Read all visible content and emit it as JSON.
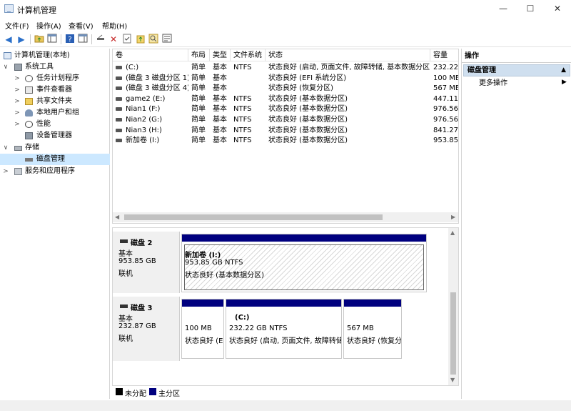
{
  "window": {
    "title": "计算机管理",
    "controls": {
      "minimize": "—",
      "maximize": "☐",
      "close": "✕"
    }
  },
  "menu": [
    "文件(F)",
    "操作(A)",
    "查看(V)",
    "帮助(H)"
  ],
  "toolbar": [
    "back-icon",
    "forward-icon",
    "folder-up-icon",
    "show-hide-tree-icon",
    "help-icon",
    "view-icon",
    "connect-icon",
    "delete-icon",
    "check-icon",
    "open-icon",
    "search-icon",
    "properties-icon"
  ],
  "tree": [
    {
      "label": "计算机管理(本地)",
      "level": 0,
      "twisty": ""
    },
    {
      "label": "系统工具",
      "level": 1,
      "twisty": "∨"
    },
    {
      "label": "任务计划程序",
      "level": 2,
      "twisty": ">"
    },
    {
      "label": "事件查看器",
      "level": 2,
      "twisty": ">"
    },
    {
      "label": "共享文件夹",
      "level": 2,
      "twisty": ">"
    },
    {
      "label": "本地用户和组",
      "level": 2,
      "twisty": ">"
    },
    {
      "label": "性能",
      "level": 2,
      "twisty": ">"
    },
    {
      "label": "设备管理器",
      "level": 2,
      "twisty": ""
    },
    {
      "label": "存储",
      "level": 1,
      "twisty": "∨"
    },
    {
      "label": "磁盘管理",
      "level": 2,
      "twisty": "",
      "selected": true
    },
    {
      "label": "服务和应用程序",
      "level": 1,
      "twisty": ">"
    }
  ],
  "volume_table": {
    "columns": [
      "卷",
      "布局",
      "类型",
      "文件系统",
      "状态",
      "容量"
    ],
    "rows": [
      [
        "(C:)",
        "简单",
        "基本",
        "NTFS",
        "状态良好 (启动, 页面文件, 故障转储, 基本数据分区)",
        "232.22"
      ],
      [
        "(磁盘 3 磁盘分区 1)",
        "简单",
        "基本",
        "",
        "状态良好 (EFI 系统分区)",
        "100 ME"
      ],
      [
        "(磁盘 3 磁盘分区 4)",
        "简单",
        "基本",
        "",
        "状态良好 (恢复分区)",
        "567 ME"
      ],
      [
        "game2 (E:)",
        "简单",
        "基本",
        "NTFS",
        "状态良好 (基本数据分区)",
        "447.11"
      ],
      [
        "Nian1 (F:)",
        "简单",
        "基本",
        "NTFS",
        "状态良好 (基本数据分区)",
        "976.56"
      ],
      [
        "Nian2 (G:)",
        "简单",
        "基本",
        "NTFS",
        "状态良好 (基本数据分区)",
        "976.56"
      ],
      [
        "Nian3 (H:)",
        "简单",
        "基本",
        "NTFS",
        "状态良好 (基本数据分区)",
        "841.27"
      ],
      [
        "新加卷 (I:)",
        "简单",
        "基本",
        "NTFS",
        "状态良好 (基本数据分区)",
        "953.85"
      ]
    ]
  },
  "disks": [
    {
      "title": "磁盘 2",
      "type": "基本",
      "size": "953.85 GB",
      "status": "联机",
      "partitions": [
        {
          "name": "新加卷  (I:)",
          "size": "953.85 GB NTFS",
          "status": "状态良好 (基本数据分区)",
          "selected": true
        }
      ]
    },
    {
      "title": "磁盘 3",
      "type": "基本",
      "size": "232.87 GB",
      "status": "联机",
      "partitions": [
        {
          "name": "",
          "size": "100 MB",
          "status": "状态良好 (E"
        },
        {
          "name": "(C:)",
          "size": "232.22 GB NTFS",
          "status": "状态良好 (启动, 页面文件, 故障转储"
        },
        {
          "name": "",
          "size": "567 MB",
          "status": "状态良好 (恢复分"
        }
      ]
    }
  ],
  "legend": [
    {
      "label": "未分配",
      "color": "#000000"
    },
    {
      "label": "主分区",
      "color": "#00007f"
    }
  ],
  "actions": {
    "header": "操作",
    "section": "磁盘管理",
    "more": "更多操作"
  }
}
